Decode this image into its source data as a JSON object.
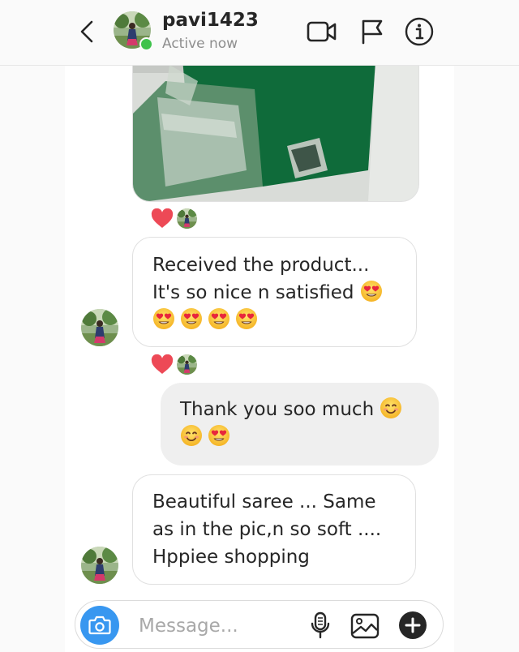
{
  "header": {
    "username": "pavi1423",
    "status": "Active now",
    "icons": [
      "back-chevron-icon",
      "video-call-icon",
      "flag-icon",
      "info-icon"
    ]
  },
  "messages": [
    {
      "type": "image",
      "from": "them",
      "description": "green saree with silver border",
      "reactions": [
        "heart-icon",
        "avatar"
      ]
    },
    {
      "type": "text",
      "from": "them",
      "lines": [
        "Received the product...",
        "It's so nice n satisfied"
      ],
      "emoji_line_1": "heart-eyes-emoji",
      "emoji_line_2": [
        "heart-eyes-emoji",
        "heart-eyes-emoji",
        "heart-eyes-emoji",
        "heart-eyes-emoji"
      ],
      "reactions": [
        "heart-icon",
        "avatar"
      ]
    },
    {
      "type": "text",
      "from": "me",
      "lines": [
        "Thank you soo much"
      ],
      "emoji_line_1": "smiling-face-emoji",
      "emoji_line_2": [
        "smiling-face-emoji",
        "heart-eyes-emoji"
      ]
    },
    {
      "type": "text",
      "from": "them",
      "lines": [
        "Beautiful saree ... Same",
        "as in the pic,n so soft ....",
        "Hppiee shopping"
      ]
    }
  ],
  "composer": {
    "placeholder": "Message...",
    "icons": [
      "camera-icon",
      "microphone-icon",
      "gallery-icon",
      "add-icon"
    ]
  },
  "colors": {
    "accent": "#3897f0",
    "online": "#3ec24b",
    "heart": "#ed4956",
    "outgoing_bubble": "#efefef"
  }
}
